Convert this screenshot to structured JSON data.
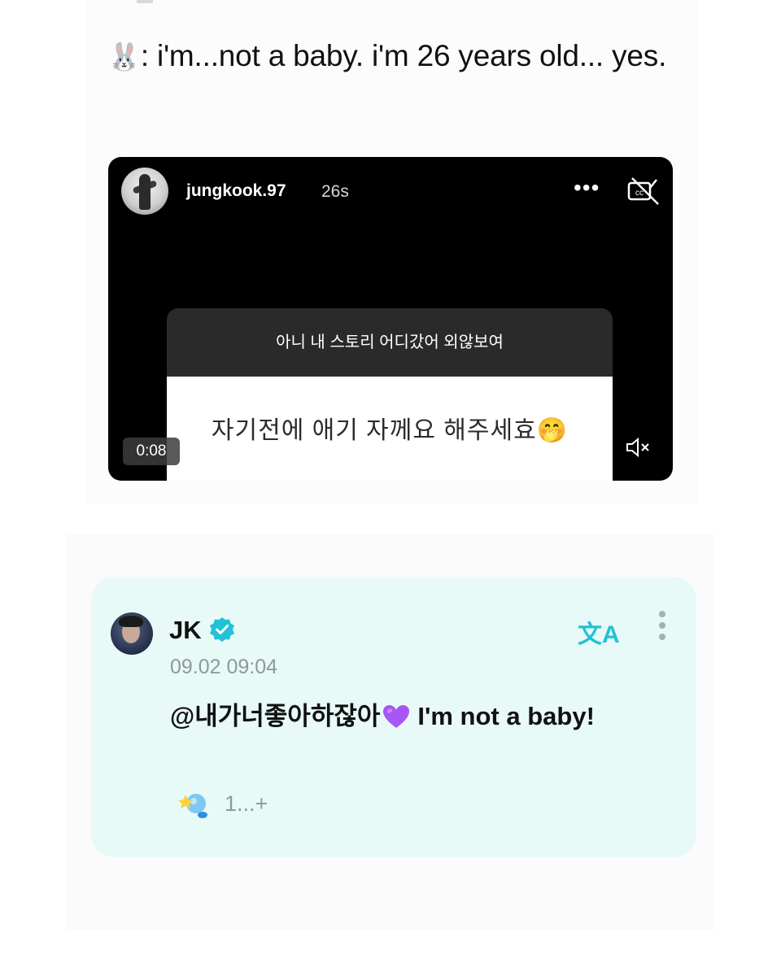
{
  "caption": {
    "emoji": "🐰",
    "text": ": i'm...not a baby. i'm 26 years old... yes."
  },
  "story": {
    "username": "jungkook.97",
    "time_ago": "26s",
    "more_label": "•••",
    "question_prompt": "아니 내 스토리 어디갔어 외않보여",
    "question_answer": "자기전에 애기 자께요 해주세효🤭",
    "video_time": "0:08",
    "icons": [
      "avatar",
      "more-icon",
      "captions-off-icon",
      "mute-icon"
    ]
  },
  "comment": {
    "author": "JK",
    "timestamp": "09.02 09:04",
    "mention": "@내가너좋아하잖아",
    "message": "I'm not a baby!",
    "translate_label": "文A",
    "reaction_count": "1...+",
    "icons": [
      "verified-badge-icon",
      "translate-icon",
      "kebab-menu-icon",
      "purple-heart-icon",
      "reaction-icon"
    ],
    "colors": {
      "card_background": "#e8faf7",
      "accent": "#21c2d6",
      "heart": "#a855f7"
    }
  }
}
